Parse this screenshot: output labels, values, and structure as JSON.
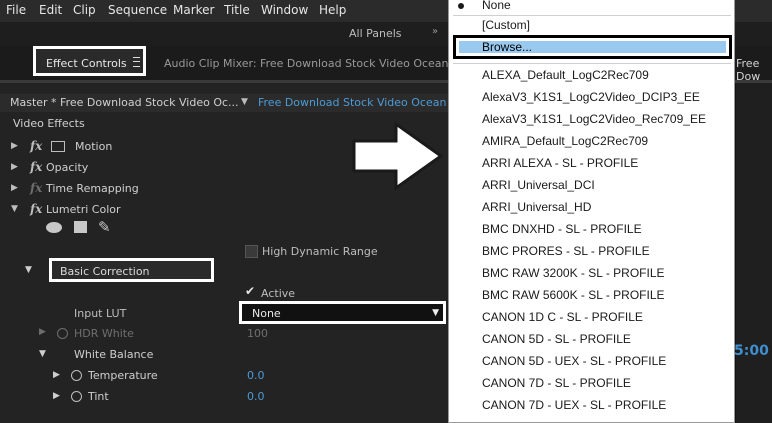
{
  "menu": [
    "File",
    "Edit",
    "Clip",
    "Sequence",
    "Marker",
    "Title",
    "Window",
    "Help"
  ],
  "workspace": {
    "label": "All Panels"
  },
  "tabs": {
    "effect_controls": "Effect Controls",
    "audio_mixer": "Audio Clip Mixer: Free Download Stock Video Ocean Wa",
    "right": "Free Dow"
  },
  "panel": {
    "source": "Master * Free Download Stock Video Oc...",
    "sequence": "Free Download Stock Video Ocean Wa",
    "video_effects": "Video Effects",
    "effects": [
      "Motion",
      "Opacity",
      "Time Remapping",
      "Lumetri Color"
    ],
    "hdr_label": "High Dynamic Range",
    "basic_correction": "Basic Correction",
    "active_label": "Active",
    "input_lut_label": "Input LUT",
    "input_lut_value": "None",
    "hdr_white": "HDR White",
    "hdr_white_value": "100",
    "white_balance": "White Balance",
    "temperature": "Temperature",
    "temperature_value": "0.0",
    "tint": "Tint",
    "tint_value": "0.0",
    "timecode": "5:00"
  },
  "dropdown": {
    "none": "None",
    "custom": "[Custom]",
    "browse": "Browse...",
    "items": [
      "ALEXA_Default_LogC2Rec709",
      "AlexaV3_K1S1_LogC2Video_DCIP3_EE",
      "AlexaV3_K1S1_LogC2Video_Rec709_EE",
      "AMIRA_Default_LogC2Rec709",
      "ARRI ALEXA - SL - PROFILE",
      "ARRI_Universal_DCI",
      "ARRI_Universal_HD",
      "BMC DNXHD - SL - PROFILE",
      "BMC PRORES - SL - PROFILE",
      "BMC RAW 3200K - SL - PROFILE",
      "BMC RAW 5600K - SL - PROFILE",
      "CANON 1D C - SL - PROFILE",
      "CANON 5D - SL - PROFILE",
      "CANON 5D - UEX - SL - PROFILE",
      "CANON 7D - SL - PROFILE",
      "CANON 7D - UEX - SL - PROFILE"
    ]
  },
  "colors": {
    "accent_blue": "#4d9bd6",
    "highlight": "#99c9ef"
  }
}
